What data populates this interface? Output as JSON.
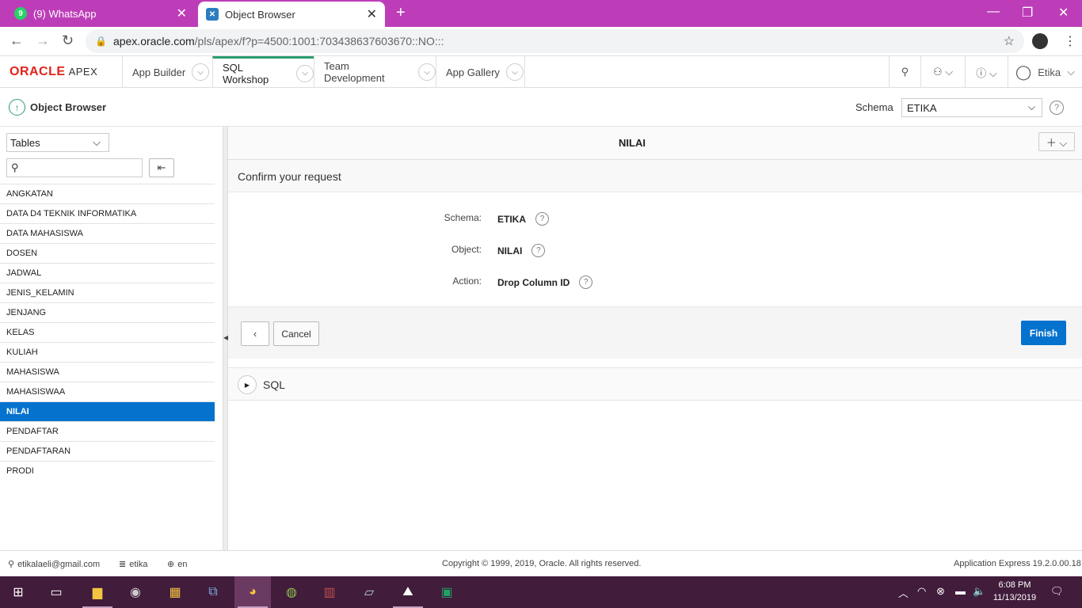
{
  "browser": {
    "tabs": [
      {
        "title": "(9) WhatsApp",
        "icon": "whatsapp-icon",
        "icon_color": "#25d366",
        "badge": "9"
      },
      {
        "title": "Object Browser",
        "icon": "apex-icon",
        "icon_color": "#2c7dbf"
      }
    ],
    "url_host": "apex.oracle.com",
    "url_path": "/pls/apex/f?p=4500:1001:703438637603670::NO:::",
    "accent": "#bd3db8"
  },
  "apex": {
    "logo_main": "ORACLE",
    "logo_sub": "APEX",
    "nav": [
      "App Builder",
      "SQL Workshop",
      "Team Development",
      "App Gallery"
    ],
    "active_nav": "SQL Workshop",
    "user": "Etika"
  },
  "pagebar": {
    "title": "Object Browser",
    "schema_label": "Schema",
    "schema_value": "ETIKA"
  },
  "left": {
    "type_select": "Tables",
    "objects": [
      "ANGKATAN",
      "DATA D4 TEKNIK INFORMATIKA",
      "DATA MAHASISWA",
      "DOSEN",
      "JADWAL",
      "JENIS_KELAMIN",
      "JENJANG",
      "KELAS",
      "KULIAH",
      "MAHASISWA",
      "MAHASISWAA",
      "NILAI",
      "PENDAFTAR",
      "PENDAFTARAN",
      "PRODI"
    ],
    "selected": "NILAI"
  },
  "main": {
    "object_title": "NILAI",
    "confirm_title": "Confirm your request",
    "fields": [
      {
        "label": "Schema:",
        "value": "ETIKA"
      },
      {
        "label": "Object:",
        "value": "NILAI"
      },
      {
        "label": "Action:",
        "value": "Drop Column ID"
      }
    ],
    "cancel_label": "Cancel",
    "finish_label": "Finish",
    "sql_label": "SQL"
  },
  "footer": {
    "email": "etikalaeli@gmail.com",
    "workspace": "etika",
    "language": "en",
    "copyright": "Copyright © 1999, 2019, Oracle. All rights reserved.",
    "version": "Application Express 19.2.0.00.18"
  },
  "taskbar": {
    "time": "6:08 PM",
    "date": "11/13/2019"
  }
}
